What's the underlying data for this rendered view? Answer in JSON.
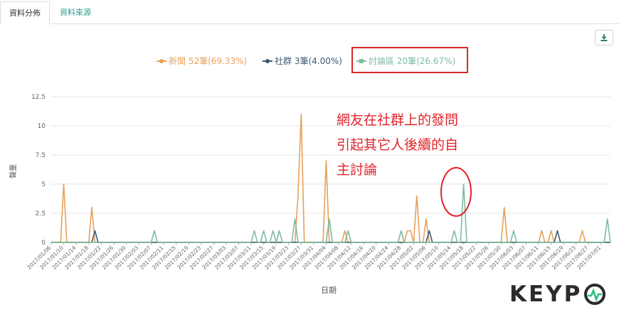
{
  "tabs": [
    {
      "label": "資料分佈",
      "active": true
    },
    {
      "label": "資料來源",
      "active": false
    }
  ],
  "toolbar": {
    "download_icon": "download-icon"
  },
  "annotation": {
    "lines": [
      "網友在社群上的發問",
      "引起其它人後續的自",
      "主討論"
    ],
    "color": "#e0242b"
  },
  "logo": {
    "text_a": "KEYP",
    "icon": "pulse-circle-icon",
    "accent": "#2bbf7e"
  },
  "chart_data": {
    "type": "line",
    "xlabel": "日期",
    "ylabel": "聲量",
    "ylim": [
      0,
      12.5
    ],
    "yticks": [
      "0",
      "2.5",
      "5",
      "7.5",
      "10",
      "12.5"
    ],
    "grid": true,
    "legend_position": "top-center",
    "xtick_labels": [
      "2017/01/06",
      "2017/01/10",
      "2017/01/14",
      "2017/01/18",
      "2017/01/22",
      "2017/01/26",
      "2017/01/30",
      "2017/02/03",
      "2017/02/07",
      "2017/02/11",
      "2017/02/15",
      "2017/02/19",
      "2017/02/23",
      "2017/02/27",
      "2017/03/03",
      "2017/03/07",
      "2017/03/11",
      "2017/03/15",
      "2017/03/19",
      "2017/03/23",
      "2017/03/27",
      "2017/03/31",
      "2017/04/04",
      "2017/04/08",
      "2017/04/12",
      "2017/04/16",
      "2017/04/20",
      "2017/04/24",
      "2017/04/28",
      "2017/05/02",
      "2017/05/06",
      "2017/05/10",
      "2017/05/14",
      "2017/05/18",
      "2017/05/22",
      "2017/05/26",
      "2017/05/30",
      "2017/06/03",
      "2017/06/07",
      "2017/06/11",
      "2017/06/15",
      "2017/06/19",
      "2017/06/23",
      "2017/06/27",
      "2017/07/01"
    ],
    "x_start": "2017-01-06",
    "x_end": "2017-07-04",
    "series": [
      {
        "name": "新聞 52筆(69.33%)",
        "color": "#e8a15a",
        "points": [
          [
            "2017-01-10",
            5
          ],
          [
            "2017-01-19",
            3
          ],
          [
            "2017-03-26",
            4
          ],
          [
            "2017-03-27",
            11
          ],
          [
            "2017-04-04",
            7
          ],
          [
            "2017-04-10",
            1
          ],
          [
            "2017-04-30",
            1
          ],
          [
            "2017-05-01",
            1
          ],
          [
            "2017-05-03",
            4
          ],
          [
            "2017-05-06",
            2
          ],
          [
            "2017-05-31",
            3
          ],
          [
            "2017-06-12",
            1
          ],
          [
            "2017-06-15",
            1
          ],
          [
            "2017-06-25",
            1
          ],
          [
            "2017-07-08",
            1
          ]
        ]
      },
      {
        "name": "社群 3筆(4.00%)",
        "color": "#3d5a73",
        "points": [
          [
            "2017-01-20",
            1
          ],
          [
            "2017-05-07",
            1
          ],
          [
            "2017-06-17",
            1
          ]
        ]
      },
      {
        "name": "討論區 20筆(26.67%)",
        "color": "#7dbba0",
        "points": [
          [
            "2017-02-08",
            1
          ],
          [
            "2017-03-12",
            1
          ],
          [
            "2017-03-15",
            1
          ],
          [
            "2017-03-18",
            1
          ],
          [
            "2017-03-20",
            1
          ],
          [
            "2017-03-25",
            2
          ],
          [
            "2017-04-05",
            2
          ],
          [
            "2017-04-11",
            1
          ],
          [
            "2017-04-28",
            1
          ],
          [
            "2017-05-15",
            1
          ],
          [
            "2017-05-18",
            5
          ],
          [
            "2017-06-03",
            1
          ],
          [
            "2017-07-03",
            2
          ]
        ]
      }
    ]
  }
}
